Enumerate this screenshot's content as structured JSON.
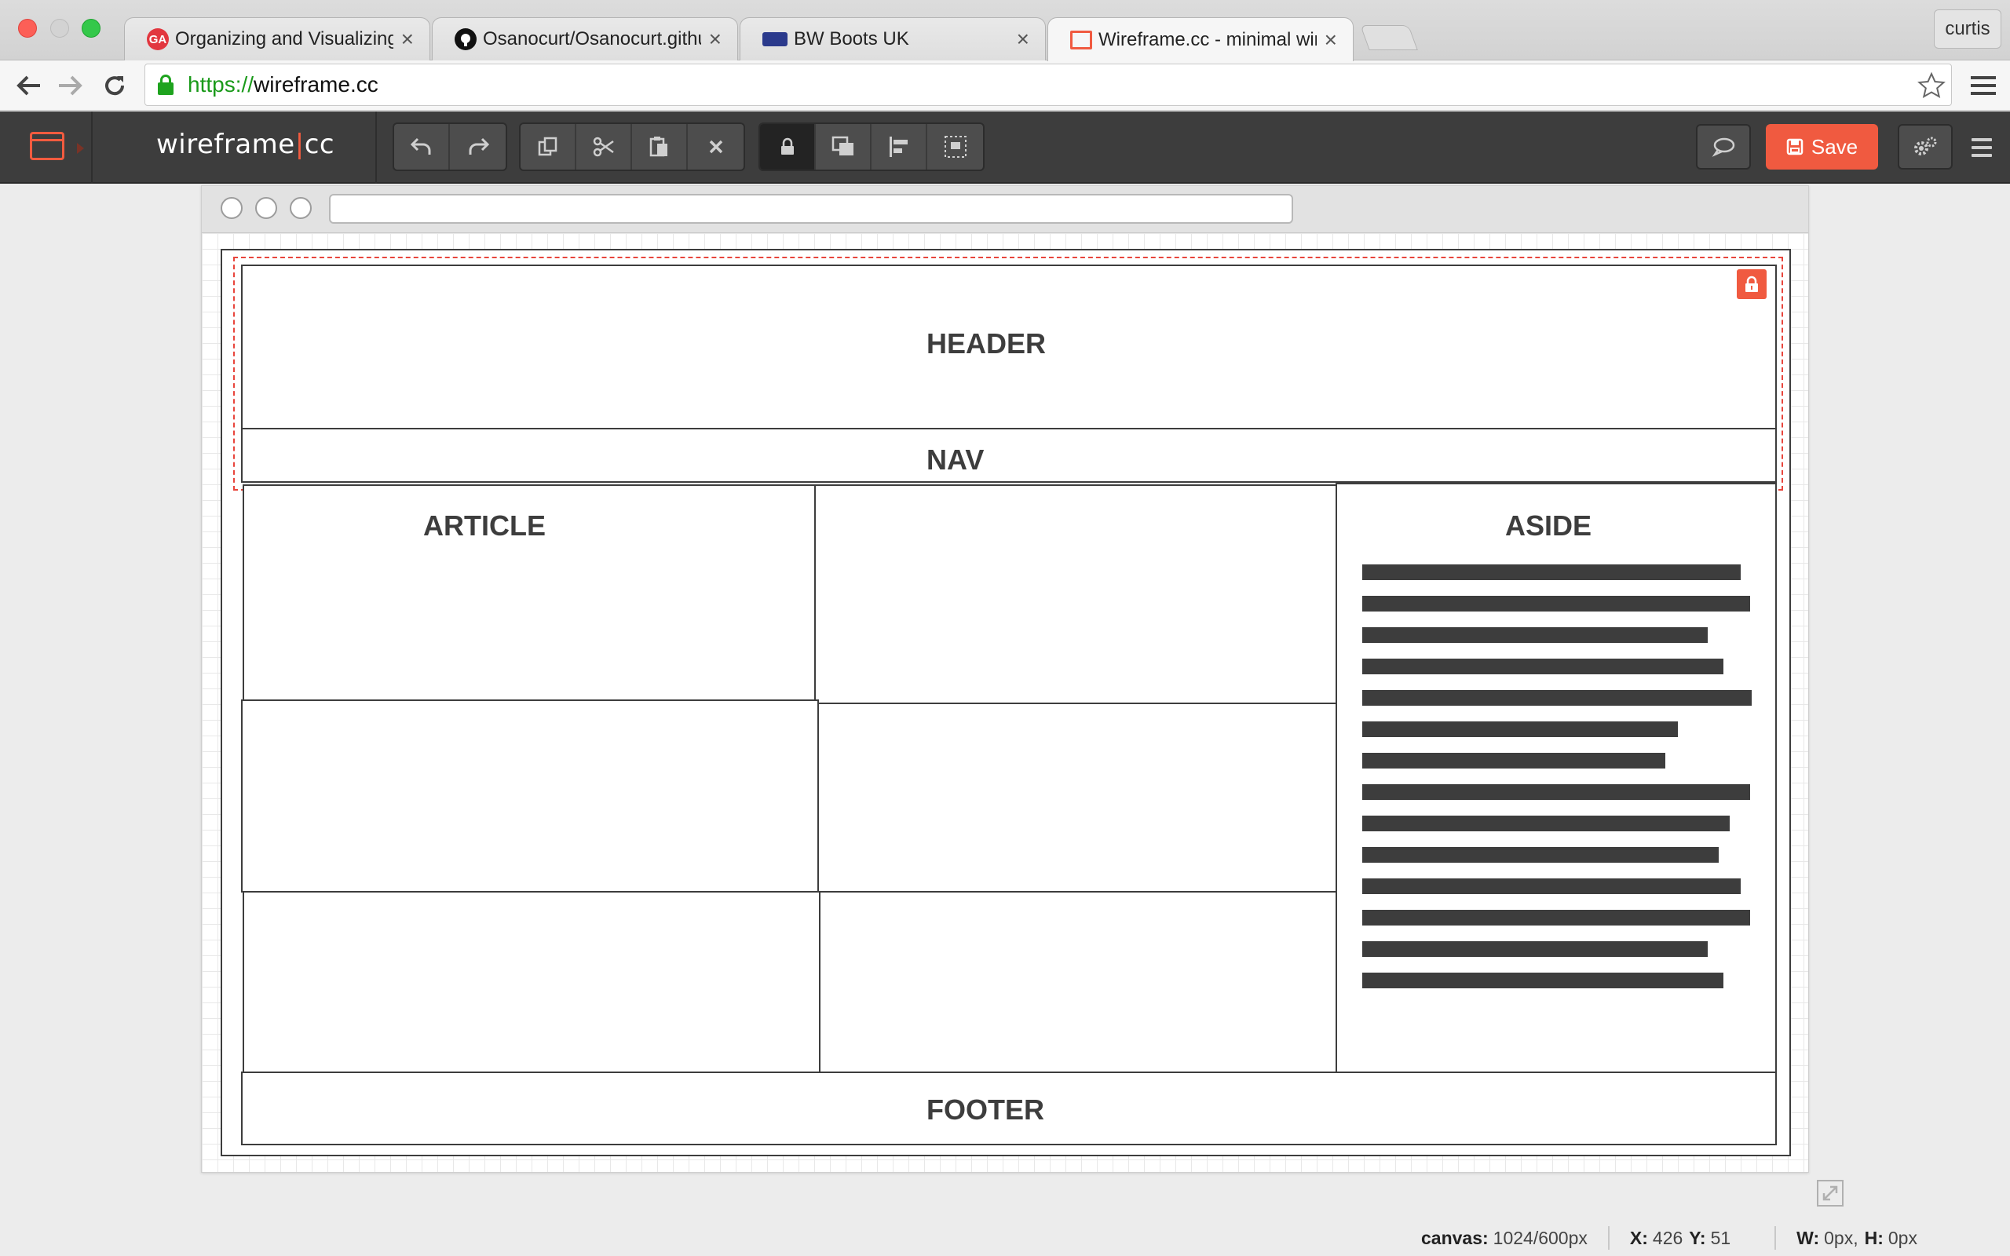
{
  "browser": {
    "tabs": [
      {
        "title": "Organizing and Visualizing",
        "favicon": "ga-icon",
        "active": false
      },
      {
        "title": "Osanocurt/Osanocurt.githu",
        "favicon": "github-icon",
        "active": false
      },
      {
        "title": "BW Boots UK",
        "favicon": "bwboots-icon",
        "active": false
      },
      {
        "title": "Wireframe.cc - minimal wir",
        "favicon": "wireframe-icon",
        "active": true
      }
    ],
    "profile": "curtis",
    "url_scheme": "https://",
    "url_host": "wireframe.cc"
  },
  "app": {
    "logo_main": "wireframe",
    "logo_pipe": "|",
    "logo_cc": "cc",
    "save_label": "Save",
    "accent": "#f05a40"
  },
  "wireframe": {
    "header": "HEADER",
    "nav": "NAV",
    "article": "ARTICLE",
    "aside": "ASIDE",
    "footer": "FOOTER",
    "aside_line_count": 14
  },
  "status": {
    "canvas_label": "canvas:",
    "canvas_value": "1024/600px",
    "xy_x_label": "X:",
    "xy_x_value": "426",
    "xy_y_label": "Y:",
    "xy_y_value": "51",
    "w_label": "W:",
    "w_value": "0px,",
    "h_label": "H:",
    "h_value": "0px"
  }
}
